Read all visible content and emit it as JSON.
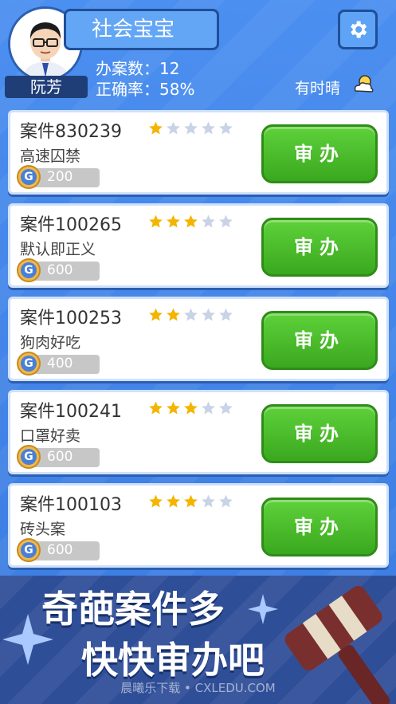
{
  "player": {
    "name": "阮芳",
    "title": "社会宝宝",
    "cases_handled_label": "办案数：",
    "cases_handled": "12",
    "accuracy_label": "正确率：",
    "accuracy": "58%",
    "weather": "有时晴"
  },
  "cases": [
    {
      "title": "案件830239",
      "stars": 1,
      "max_stars": 5,
      "name": "高速囚禁",
      "reward": "200",
      "button": "审办"
    },
    {
      "title": "案件100265",
      "stars": 3,
      "max_stars": 5,
      "name": "默认即正义",
      "reward": "600",
      "button": "审办"
    },
    {
      "title": "案件100253",
      "stars": 2,
      "max_stars": 5,
      "name": "狗肉好吃",
      "reward": "400",
      "button": "审办"
    },
    {
      "title": "案件100241",
      "stars": 3,
      "max_stars": 5,
      "name": "口罩好卖",
      "reward": "600",
      "button": "审办"
    },
    {
      "title": "案件100103",
      "stars": 3,
      "max_stars": 5,
      "name": "砖头案",
      "reward": "600",
      "button": "审办"
    }
  ],
  "banner": {
    "line1": "奇葩案件多",
    "line2": "快快审办吧"
  },
  "watermark": "晨曦乐下载 • CXLEDU.COM",
  "coin_letter": "G",
  "colors": {
    "background": "#3f82e6",
    "button_green": "#44b824",
    "star_gold": "#f4b400",
    "star_empty": "#c9d3e6"
  }
}
